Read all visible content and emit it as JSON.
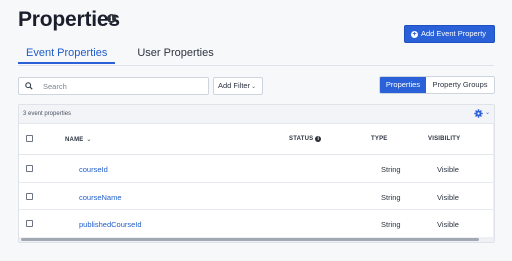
{
  "header": {
    "title": "Properties",
    "info_icon": "info-icon",
    "add_button_label": "Add Event Property",
    "add_button_icon": "plus-circle-icon"
  },
  "tabs": [
    {
      "label": "Event Properties",
      "active": true
    },
    {
      "label": "User Properties",
      "active": false
    }
  ],
  "toolbar": {
    "search_placeholder": "Search",
    "filter_label": "Add Filter",
    "view_toggle": [
      {
        "label": "Properties",
        "active": true
      },
      {
        "label": "Property Groups",
        "active": false
      }
    ]
  },
  "table": {
    "count_text": "3 event properties",
    "columns": [
      "NAME",
      "STATUS",
      "TYPE",
      "VISIBILITY"
    ],
    "rows": [
      {
        "name": "courseId",
        "type": "String",
        "visibility": "Visible"
      },
      {
        "name": "courseName",
        "type": "String",
        "visibility": "Visible"
      },
      {
        "name": "publishedCourseId",
        "type": "String",
        "visibility": "Visible"
      }
    ]
  },
  "colors": {
    "accent": "#2a61d8",
    "link": "#1f5dc9",
    "background": "#f7f8fa"
  }
}
